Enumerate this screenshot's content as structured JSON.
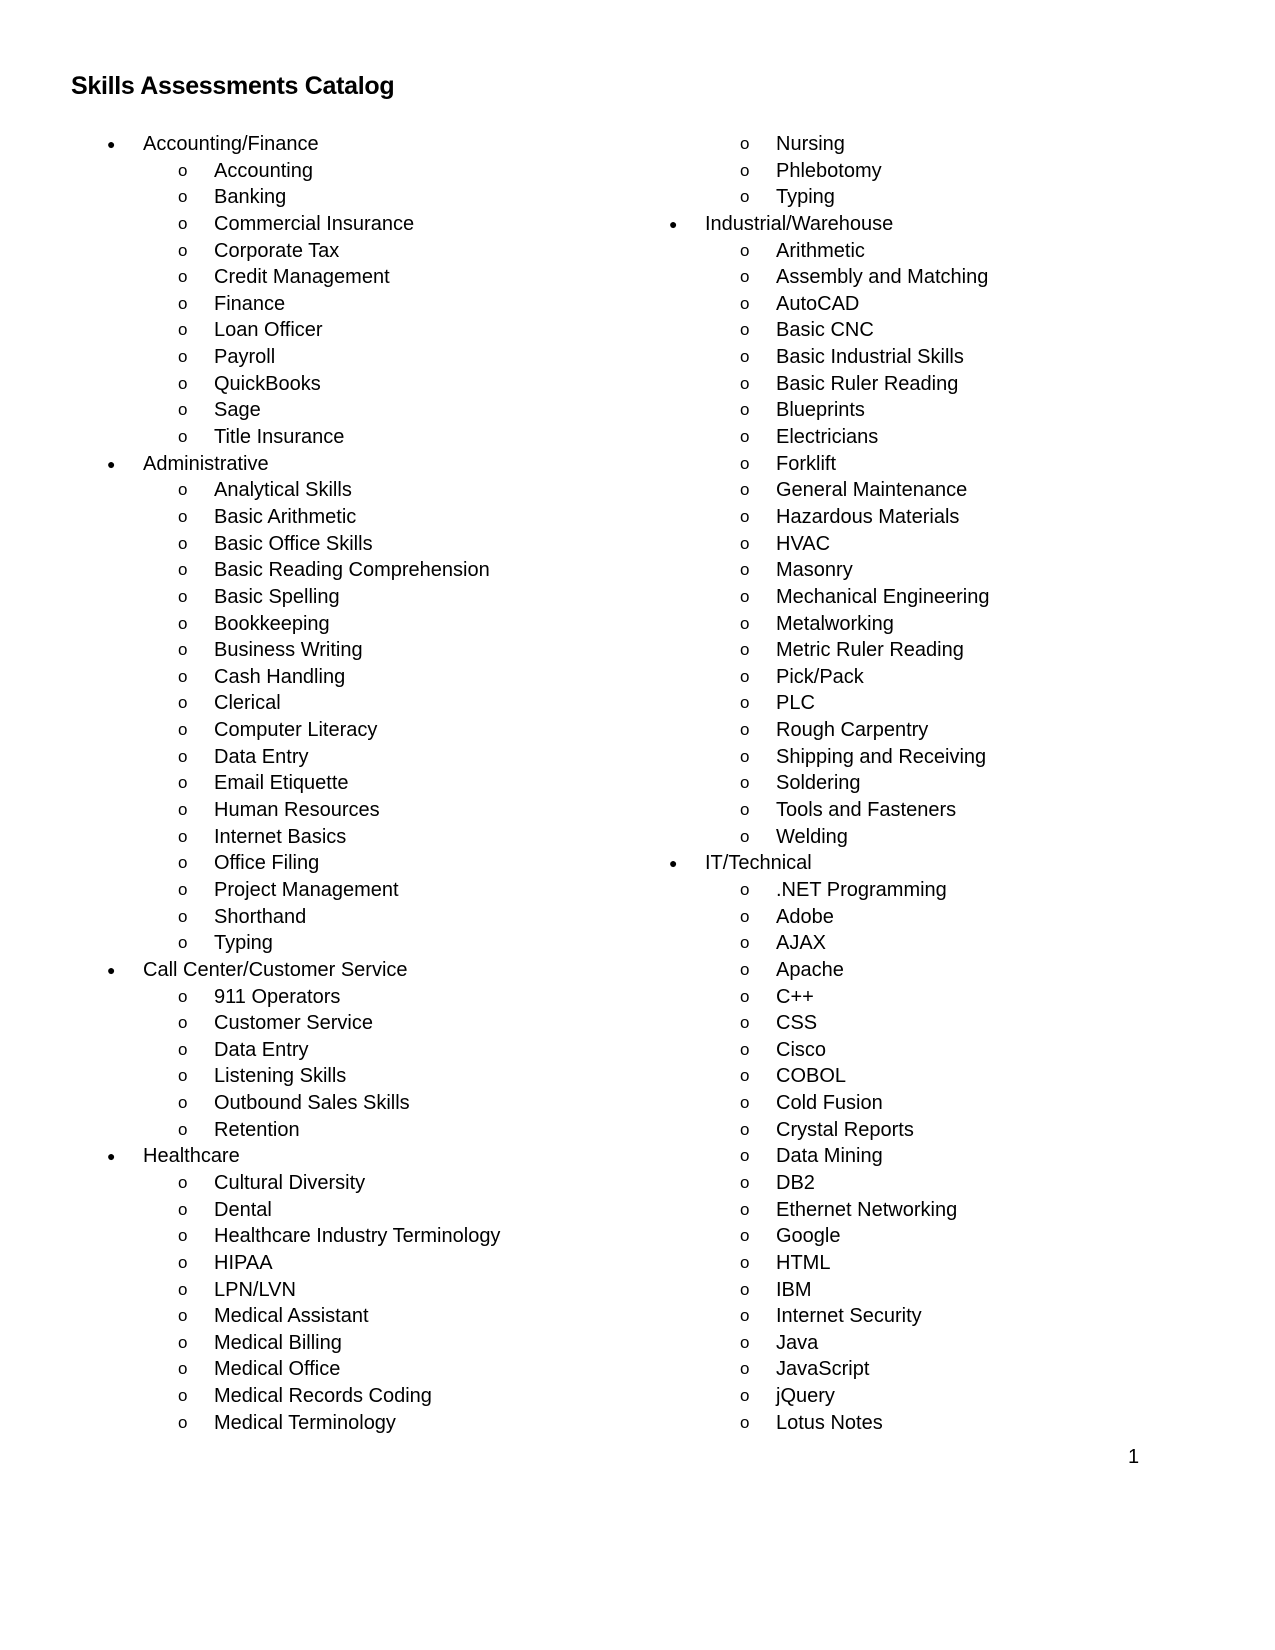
{
  "title": "Skills Assessments Catalog",
  "page_number": "1",
  "icons": {
    "category_bullet": "filled-circle-bullet",
    "item_bullet": "hollow-o-bullet"
  },
  "left_column": [
    {
      "type": "cat",
      "text": "Accounting/Finance"
    },
    {
      "type": "sub",
      "text": "Accounting"
    },
    {
      "type": "sub",
      "text": "Banking"
    },
    {
      "type": "sub",
      "text": "Commercial Insurance"
    },
    {
      "type": "sub",
      "text": "Corporate Tax"
    },
    {
      "type": "sub",
      "text": "Credit Management"
    },
    {
      "type": "sub",
      "text": "Finance"
    },
    {
      "type": "sub",
      "text": "Loan Officer"
    },
    {
      "type": "sub",
      "text": "Payroll"
    },
    {
      "type": "sub",
      "text": "QuickBooks"
    },
    {
      "type": "sub",
      "text": "Sage"
    },
    {
      "type": "sub",
      "text": "Title Insurance"
    },
    {
      "type": "cat",
      "text": "Administrative"
    },
    {
      "type": "sub",
      "text": "Analytical Skills"
    },
    {
      "type": "sub",
      "text": "Basic Arithmetic"
    },
    {
      "type": "sub",
      "text": "Basic Office Skills"
    },
    {
      "type": "sub",
      "text": "Basic Reading Comprehension"
    },
    {
      "type": "sub",
      "text": "Basic Spelling"
    },
    {
      "type": "sub",
      "text": "Bookkeeping"
    },
    {
      "type": "sub",
      "text": "Business Writing"
    },
    {
      "type": "sub",
      "text": "Cash Handling"
    },
    {
      "type": "sub",
      "text": "Clerical"
    },
    {
      "type": "sub",
      "text": "Computer Literacy"
    },
    {
      "type": "sub",
      "text": "Data Entry"
    },
    {
      "type": "sub",
      "text": "Email Etiquette"
    },
    {
      "type": "sub",
      "text": "Human Resources"
    },
    {
      "type": "sub",
      "text": "Internet Basics"
    },
    {
      "type": "sub",
      "text": "Office Filing"
    },
    {
      "type": "sub",
      "text": "Project Management"
    },
    {
      "type": "sub",
      "text": "Shorthand"
    },
    {
      "type": "sub",
      "text": "Typing"
    },
    {
      "type": "cat",
      "text": "Call Center/Customer Service"
    },
    {
      "type": "sub",
      "text": "911 Operators"
    },
    {
      "type": "sub",
      "text": "Customer Service"
    },
    {
      "type": "sub",
      "text": "Data Entry"
    },
    {
      "type": "sub",
      "text": "Listening Skills"
    },
    {
      "type": "sub",
      "text": "Outbound Sales Skills"
    },
    {
      "type": "sub",
      "text": "Retention"
    },
    {
      "type": "cat",
      "text": "Healthcare"
    },
    {
      "type": "sub",
      "text": "Cultural Diversity"
    },
    {
      "type": "sub",
      "text": "Dental"
    },
    {
      "type": "sub",
      "text": "Healthcare Industry Terminology"
    },
    {
      "type": "sub",
      "text": "HIPAA"
    },
    {
      "type": "sub",
      "text": "LPN/LVN"
    },
    {
      "type": "sub",
      "text": "Medical Assistant"
    },
    {
      "type": "sub",
      "text": "Medical Billing"
    },
    {
      "type": "sub",
      "text": "Medical Office"
    },
    {
      "type": "sub",
      "text": "Medical Records Coding"
    },
    {
      "type": "sub",
      "text": "Medical Terminology"
    }
  ],
  "right_column": [
    {
      "type": "sub",
      "text": "Nursing"
    },
    {
      "type": "sub",
      "text": "Phlebotomy"
    },
    {
      "type": "sub",
      "text": "Typing"
    },
    {
      "type": "cat",
      "text": "Industrial/Warehouse"
    },
    {
      "type": "sub",
      "text": "Arithmetic"
    },
    {
      "type": "sub",
      "text": "Assembly and Matching"
    },
    {
      "type": "sub",
      "text": "AutoCAD"
    },
    {
      "type": "sub",
      "text": "Basic CNC"
    },
    {
      "type": "sub",
      "text": "Basic Industrial Skills"
    },
    {
      "type": "sub",
      "text": "Basic Ruler Reading"
    },
    {
      "type": "sub",
      "text": "Blueprints"
    },
    {
      "type": "sub",
      "text": "Electricians"
    },
    {
      "type": "sub",
      "text": "Forklift"
    },
    {
      "type": "sub",
      "text": "General Maintenance"
    },
    {
      "type": "sub",
      "text": "Hazardous Materials"
    },
    {
      "type": "sub",
      "text": "HVAC"
    },
    {
      "type": "sub",
      "text": "Masonry"
    },
    {
      "type": "sub",
      "text": "Mechanical Engineering"
    },
    {
      "type": "sub",
      "text": "Metalworking"
    },
    {
      "type": "sub",
      "text": "Metric Ruler Reading"
    },
    {
      "type": "sub",
      "text": "Pick/Pack"
    },
    {
      "type": "sub",
      "text": "PLC"
    },
    {
      "type": "sub",
      "text": "Rough Carpentry"
    },
    {
      "type": "sub",
      "text": "Shipping and Receiving"
    },
    {
      "type": "sub",
      "text": "Soldering"
    },
    {
      "type": "sub",
      "text": "Tools and Fasteners"
    },
    {
      "type": "sub",
      "text": "Welding"
    },
    {
      "type": "cat",
      "text": "IT/Technical"
    },
    {
      "type": "sub",
      "text": ".NET Programming"
    },
    {
      "type": "sub",
      "text": "Adobe"
    },
    {
      "type": "sub",
      "text": "AJAX"
    },
    {
      "type": "sub",
      "text": "Apache"
    },
    {
      "type": "sub",
      "text": "C++"
    },
    {
      "type": "sub",
      "text": "CSS"
    },
    {
      "type": "sub",
      "text": "Cisco"
    },
    {
      "type": "sub",
      "text": "COBOL"
    },
    {
      "type": "sub",
      "text": "Cold Fusion"
    },
    {
      "type": "sub",
      "text": "Crystal Reports"
    },
    {
      "type": "sub",
      "text": "Data Mining"
    },
    {
      "type": "sub",
      "text": "DB2"
    },
    {
      "type": "sub",
      "text": "Ethernet Networking"
    },
    {
      "type": "sub",
      "text": "Google"
    },
    {
      "type": "sub",
      "text": "HTML"
    },
    {
      "type": "sub",
      "text": "IBM"
    },
    {
      "type": "sub",
      "text": "Internet Security"
    },
    {
      "type": "sub",
      "text": "Java"
    },
    {
      "type": "sub",
      "text": "JavaScript"
    },
    {
      "type": "sub",
      "text": "jQuery"
    },
    {
      "type": "sub",
      "text": "Lotus Notes"
    }
  ]
}
